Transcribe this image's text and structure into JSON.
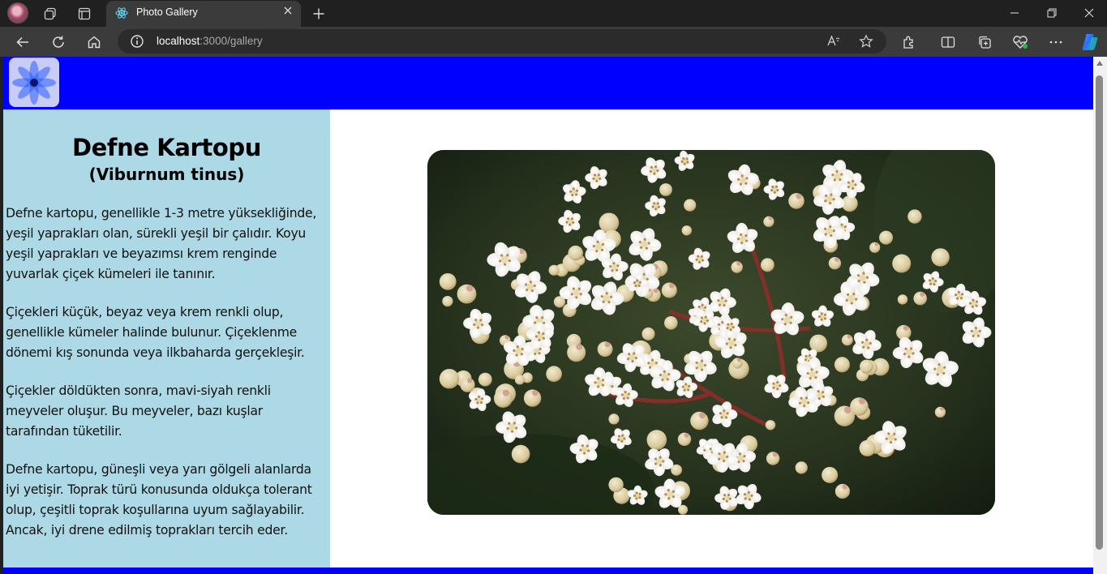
{
  "browser": {
    "tab_title": "Photo Gallery",
    "url_host": "localhost",
    "url_rest": ":3000/gallery",
    "icons": [
      "profile-avatar",
      "workspaces-icon",
      "tab-actions-icon",
      "react-favicon",
      "close-icon",
      "new-tab-icon",
      "minimize-icon",
      "restore-icon",
      "window-close-icon",
      "back-icon",
      "refresh-icon",
      "home-icon",
      "info-icon",
      "read-aloud-icon",
      "favorite-star-icon",
      "extensions-icon",
      "split-screen-icon",
      "collections-icon",
      "browser-essentials-icon",
      "more-options-icon",
      "copilot-icon"
    ]
  },
  "colors": {
    "header": "#0000ff",
    "sidebar": "#add8e6",
    "chrome_dark": "#202020",
    "chrome_toolbar": "#3b3b3b"
  },
  "page": {
    "plant": {
      "name": "Defne Kartopu",
      "latin": "(Viburnum tinus)",
      "paragraphs": [
        "Defne kartopu, genellikle 1-3 metre yüksekliğinde, yeşil yaprakları olan, sürekli yeşil bir çalıdır. Koyu yeşil yaprakları ve beyazımsı krem renginde yuvarlak çiçek kümeleri ile tanınır.",
        "Çiçekleri küçük, beyaz veya krem renkli olup, genellikle kümeler halinde bulunur. Çiçeklenme dönemi kış sonunda veya ilkbaharda gerçekleşir.",
        "Çiçekler döldükten sonra, mavi-siyah renkli meyveler oluşur. Bu meyveler, bazı kuşlar tarafından tüketilir.",
        "Defne kartopu, güneşli veya yarı gölgeli alanlarda iyi yetişir. Toprak türü konusunda oldukça tolerant olup, çeşitli toprak koşullarına uyum sağlayabilir. Ancak, iyi drene edilmiş toprakları tercih eder."
      ]
    }
  }
}
